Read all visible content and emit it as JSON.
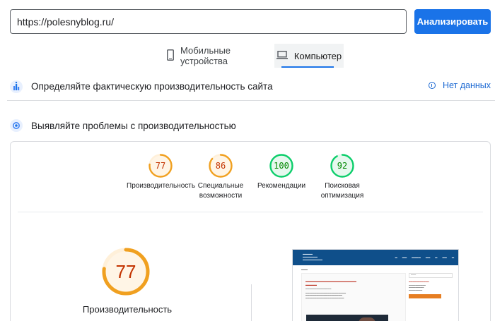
{
  "url_bar": {
    "value": "https://polesnyblog.ru/",
    "analyze_label": "Анализировать"
  },
  "tabs": [
    {
      "label": "Мобильные устройства",
      "icon": "smartphone-icon",
      "selected": false
    },
    {
      "label": "Компьютер",
      "icon": "laptop-icon",
      "selected": true
    }
  ],
  "sections": {
    "field_data": {
      "title": "Определяйте фактическую производительность сайта",
      "icon": "field-data-icon",
      "no_data_label": "Нет данных"
    },
    "diagnose": {
      "title": "Выявляйте проблемы с производительностью",
      "icon": "lab-data-icon"
    }
  },
  "categories": [
    {
      "score": 77,
      "label": "Производительность",
      "color": "#f0a020"
    },
    {
      "score": 86,
      "label": "Специальные возможности",
      "color": "#f0a020"
    },
    {
      "score": 100,
      "label": "Рекомендации",
      "color": "#0cce6b"
    },
    {
      "score": 92,
      "label": "Поисковая оптимизация",
      "color": "#0cce6b"
    }
  ],
  "performance": {
    "score": 77,
    "label": "Производительность",
    "color": "#f0a020"
  },
  "colors": {
    "accent": "#1a73e8",
    "average": "#f0a020",
    "good": "#0cce6b"
  }
}
